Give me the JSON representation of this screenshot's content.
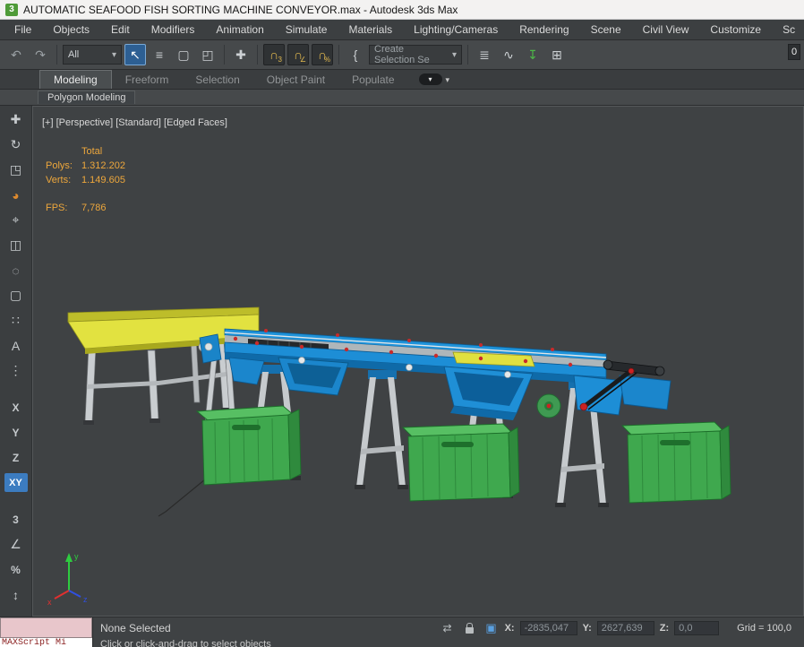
{
  "title_bar": {
    "icon_label": "3",
    "title": "AUTOMATIC SEAFOOD FISH SORTING MACHINE CONVEYOR.max - Autodesk 3ds Max"
  },
  "menu": {
    "items": [
      "File",
      "Objects",
      "Edit",
      "Modifiers",
      "Animation",
      "Simulate",
      "Materials",
      "Lighting/Cameras",
      "Rendering",
      "Scene",
      "Civil View",
      "Customize",
      "Sc"
    ]
  },
  "toolbar": {
    "undo": "↶",
    "redo": "↷",
    "filter_value": "All",
    "caret": "▾",
    "select": "↖",
    "select_by_name": "≡",
    "region": "▢",
    "window_crossing": "◰",
    "move": "✚",
    "snap_magnet": "∩",
    "snap_badge_3": "3",
    "snap_badge_angle": "∠",
    "snap_badge_percent": "%",
    "named_sets": "{",
    "selection_set_value": "Create Selection Se",
    "scene_explorer": "≣",
    "curve_editor": "∿",
    "ribbon_toggle": "↧",
    "schematic": "⊞",
    "right_value": "0"
  },
  "ribbon": {
    "tabs": [
      "Modeling",
      "Freeform",
      "Selection",
      "Object Paint",
      "Populate"
    ],
    "menu_glyph": "▾",
    "caret": "▾",
    "subtab": "Polygon Modeling"
  },
  "left_rail": {
    "move": "✚",
    "rotate": "↻",
    "scale": "◳",
    "place": "◕",
    "manipulate": "⌖",
    "pivot": "◫",
    "region_circle": "◌",
    "region_rect": "▢",
    "grid_points": "∷",
    "align": "A",
    "spacing": "⋮",
    "x": "X",
    "y": "Y",
    "z": "Z",
    "xy": "XY",
    "snap3": "3",
    "angle": "∠",
    "percent": "%",
    "spinner": "↕"
  },
  "viewport": {
    "label": "[+] [Perspective] [Standard] [Edged Faces]",
    "stats": {
      "total_label": "Total",
      "polys_label": "Polys:",
      "polys_value": "1.312.202",
      "verts_label": "Verts:",
      "verts_value": "1.149.605",
      "fps_label": "FPS:",
      "fps_value": "7,786"
    },
    "axis": {
      "x": "x",
      "y": "y",
      "z": "z"
    }
  },
  "status_bar": {
    "selection": "None Selected",
    "prompt": "Click or click-and-drag to select objects",
    "maxscript_label": "MAXScript Mi",
    "gizmo_icon": "⇄",
    "abs_icon": "▣",
    "x_label": "X:",
    "x_value": "-2835,047",
    "y_label": "Y:",
    "y_value": "2627,639",
    "z_label": "Z:",
    "z_value": "0,0",
    "grid_label": "Grid = 100,0"
  },
  "colors": {
    "accent_blue": "#1d8ed6",
    "crate_green": "#3fa84e",
    "tray_yellow": "#e2e240",
    "stats_orange": "#eda73c"
  }
}
